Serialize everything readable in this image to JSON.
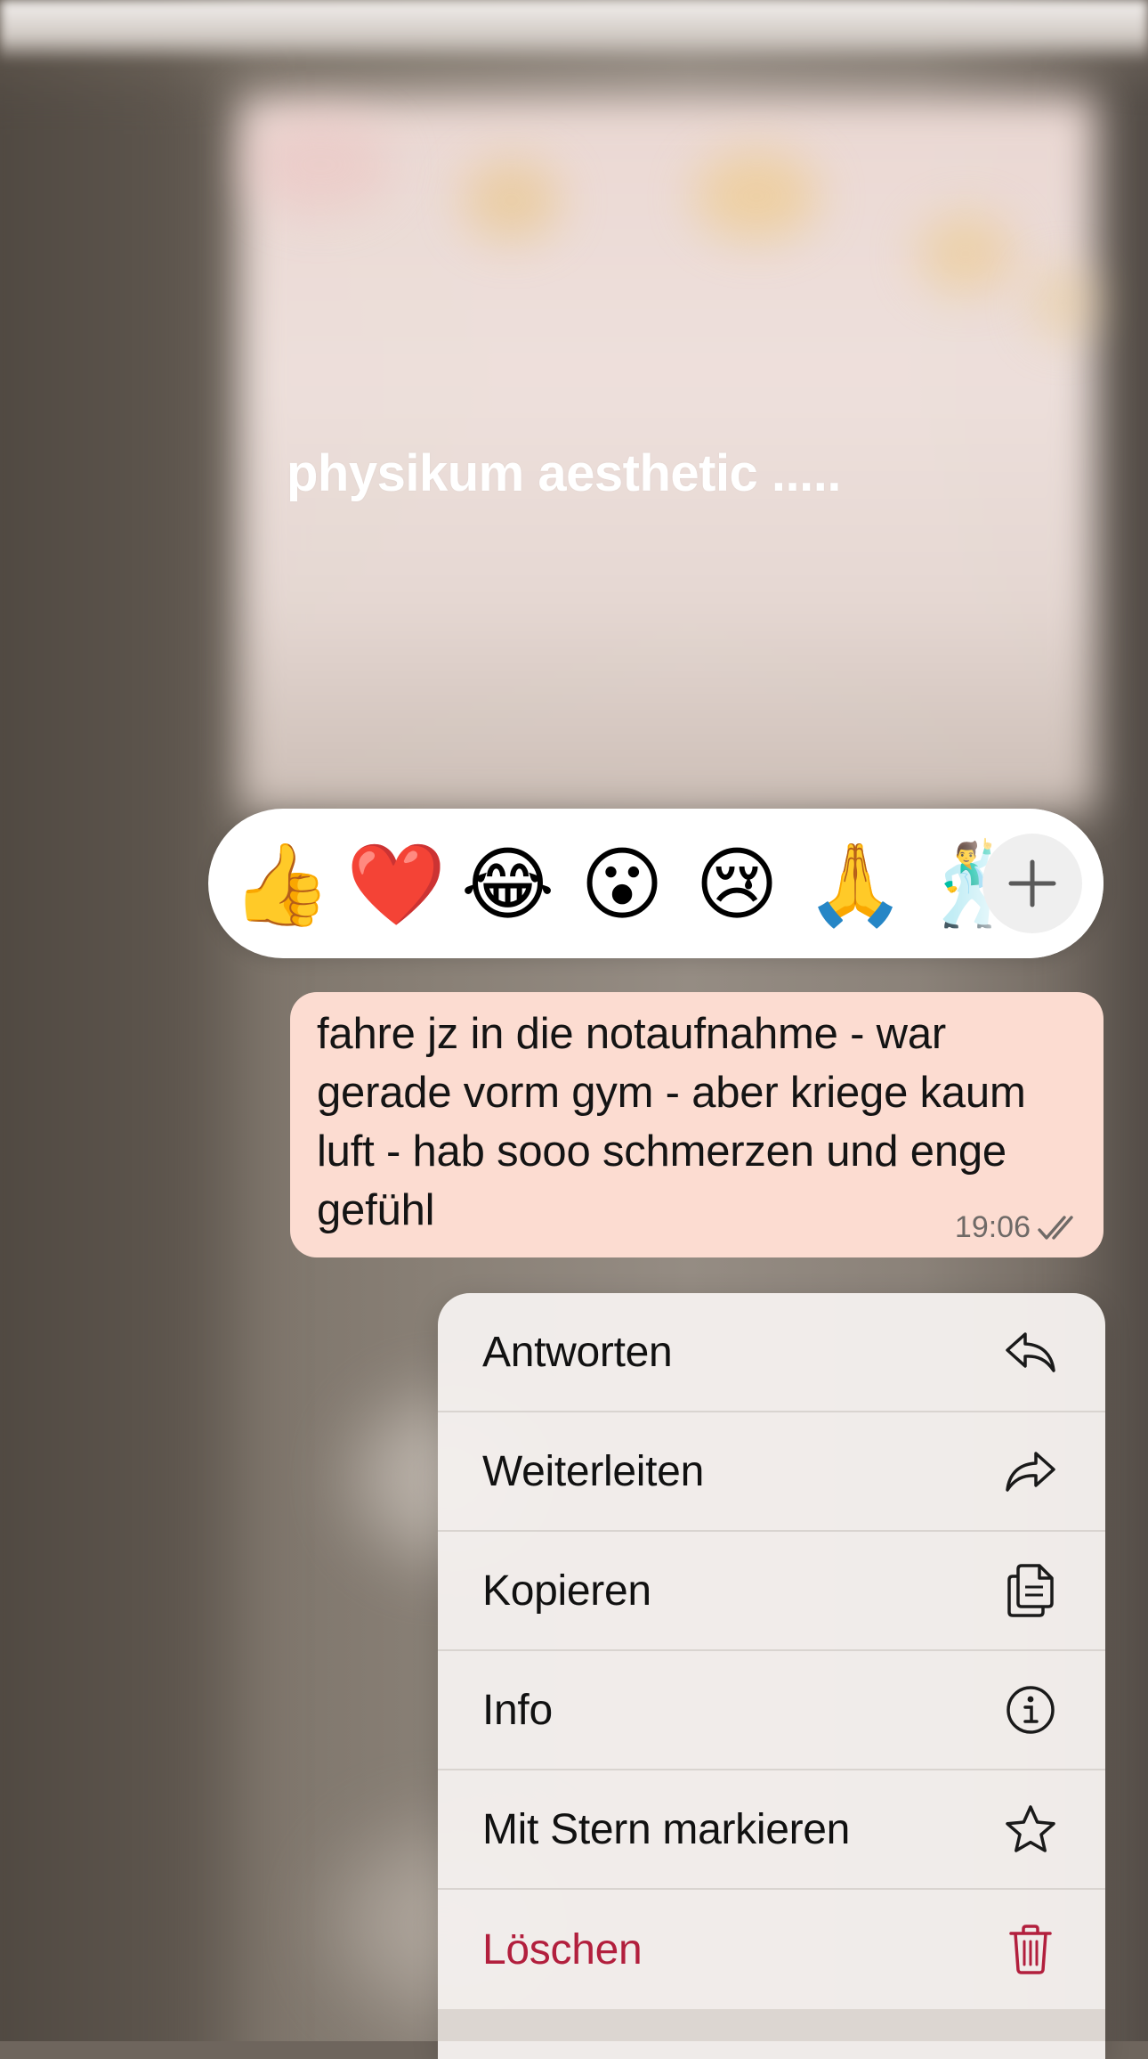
{
  "caption": "physikum aesthetic .....",
  "reactions": {
    "items": [
      {
        "emoji": "👍",
        "name": "thumbs-up"
      },
      {
        "emoji": "❤️",
        "name": "red-heart"
      },
      {
        "emoji": "😂",
        "name": "face-with-tears-of-joy"
      },
      {
        "emoji": "😮",
        "name": "face-with-open-mouth"
      },
      {
        "emoji": "😢",
        "name": "crying-face"
      },
      {
        "emoji": "🙏",
        "name": "folded-hands"
      },
      {
        "emoji": "🕺",
        "name": "man-dancing"
      }
    ],
    "more_icon": "plus-icon"
  },
  "message": {
    "text": "fahre jz in die notaufnahme - war gerade vorm gym - aber kriege kaum luft - hab sooo schmerzen und enge gefühl",
    "time": "19:06",
    "status_icon": "double-check-icon",
    "bubble_color": "#fcdcd1"
  },
  "menu": {
    "items": [
      {
        "label": "Antworten",
        "icon": "reply-icon"
      },
      {
        "label": "Weiterleiten",
        "icon": "forward-icon"
      },
      {
        "label": "Kopieren",
        "icon": "copy-icon"
      },
      {
        "label": "Info",
        "icon": "info-icon"
      },
      {
        "label": "Mit Stern markieren",
        "icon": "star-icon"
      },
      {
        "label": "Löschen",
        "icon": "trash-icon"
      }
    ],
    "danger_color": "#b21f3d"
  }
}
